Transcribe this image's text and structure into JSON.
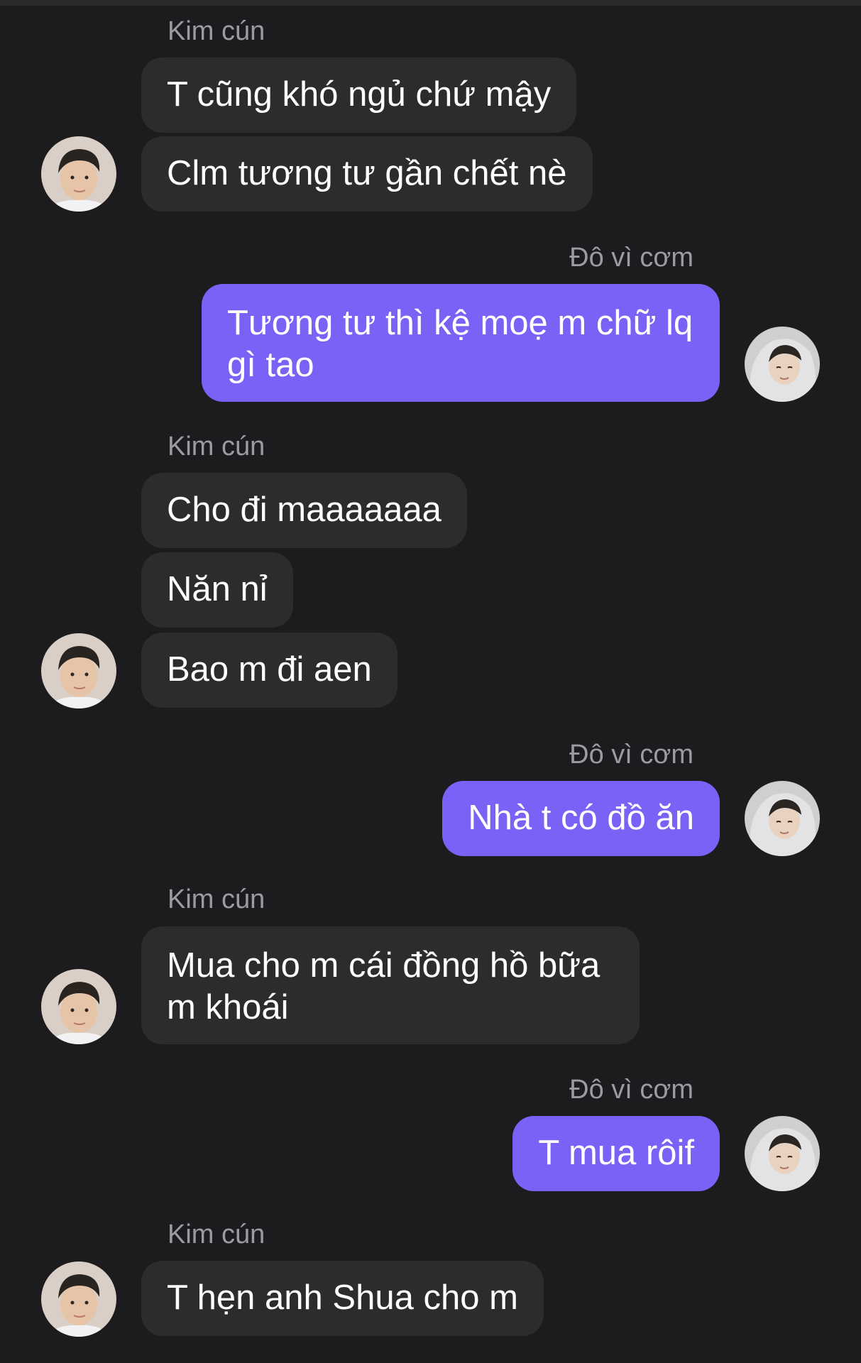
{
  "conversation": {
    "other_name": "Kim cún",
    "self_name": "Đô vì cơm",
    "messages": [
      {
        "text": "T cũng khó ngủ chứ mậy"
      },
      {
        "text": "Clm tương tư gần chết nè"
      },
      {
        "text": "Tương tư thì kệ moẹ m chữ lq gì tao"
      },
      {
        "text": "Cho đi maaaaaaa"
      },
      {
        "text": "Năn nỉ"
      },
      {
        "text": "Bao m đi aen"
      },
      {
        "text": "Nhà t có đồ ăn"
      },
      {
        "text": "Mua cho m cái đồng hồ bữa m khoái"
      },
      {
        "text": "T mua rôif"
      },
      {
        "text": "T hẹn anh Shua cho m"
      }
    ]
  },
  "colors": {
    "background": "#1c1c1e",
    "incoming_bubble": "#2c2c2e",
    "outgoing_bubble": "#7b61f6",
    "sender_name": "#9b9ba1"
  },
  "icons": {
    "other_avatar": "avatar-photo-boy",
    "self_avatar": "avatar-photo-hooded"
  }
}
